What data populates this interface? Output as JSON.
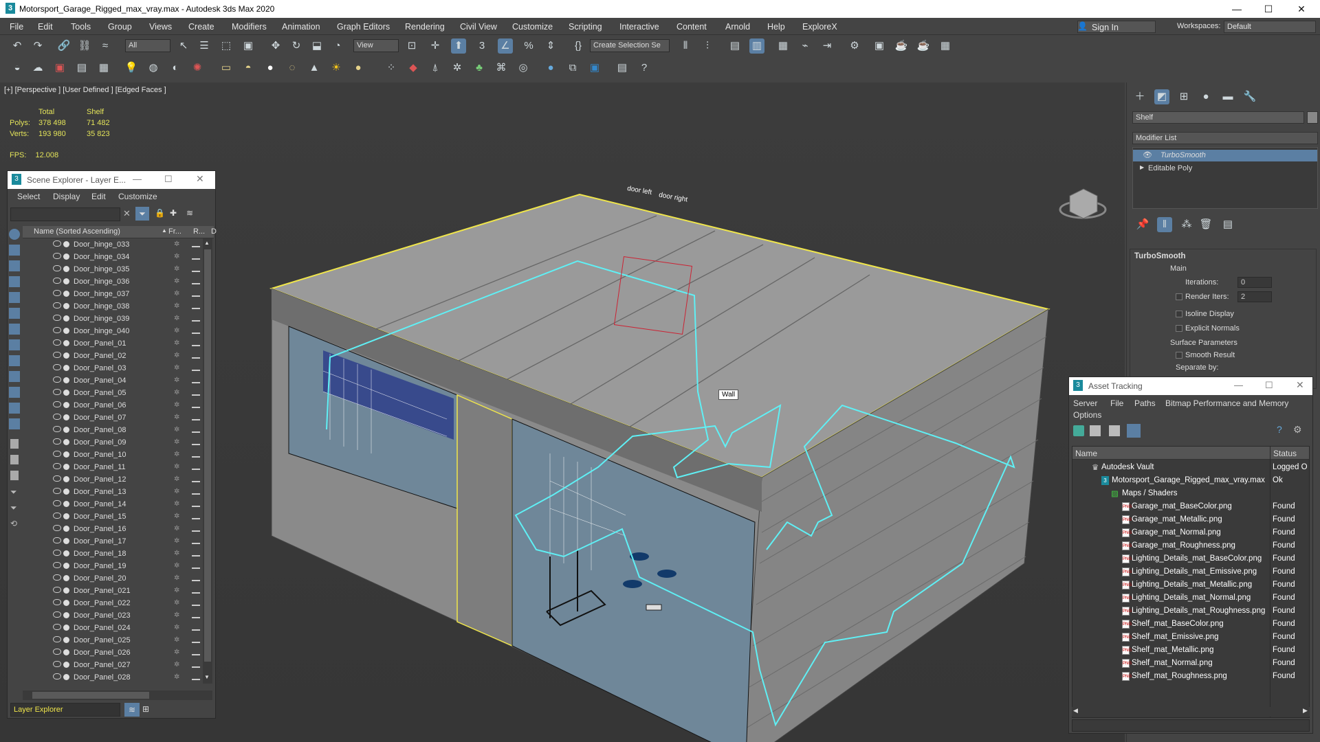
{
  "window": {
    "title": "Motorsport_Garage_Rigged_max_vray.max - Autodesk 3ds Max 2020",
    "min": "—",
    "max": "☐",
    "close": "✕"
  },
  "menu": [
    "File",
    "Edit",
    "Tools",
    "Group",
    "Views",
    "Create",
    "Modifiers",
    "Animation",
    "Graph Editors",
    "Rendering",
    "Civil View",
    "Customize",
    "Scripting",
    "Interactive",
    "Content",
    "Arnold",
    "Help",
    "ExploreX"
  ],
  "signin": {
    "label": "Sign In",
    "workspaces_label": "Workspaces:",
    "workspace": "Default"
  },
  "toolbar": {
    "filter": "All",
    "view": "View",
    "selset": "Create Selection Se",
    "snap_angle": "3"
  },
  "viewport": {
    "label": "[+] [Perspective ] [User Defined ] [Edged Faces ]",
    "stats": {
      "total_h": "Total",
      "shelf_h": "Shelf",
      "polys_l": "Polys:",
      "polys_total": "378 498",
      "polys_shelf": "71 482",
      "verts_l": "Verts:",
      "verts_total": "193 980",
      "verts_shelf": "35 823"
    },
    "fps_l": "FPS:",
    "fps": "12.008",
    "tooltip": "Wall",
    "door_left": "door left",
    "door_right": "door right"
  },
  "scene_explorer": {
    "title": "Scene Explorer - Layer E...",
    "menu": [
      "Select",
      "Display",
      "Edit",
      "Customize"
    ],
    "col_name": "Name (Sorted Ascending)",
    "col_fr": "Fr...",
    "col_r": "R...",
    "col_d": "D",
    "items": [
      "Door_hinge_033",
      "Door_hinge_034",
      "Door_hinge_035",
      "Door_hinge_036",
      "Door_hinge_037",
      "Door_hinge_038",
      "Door_hinge_039",
      "Door_hinge_040",
      "Door_Panel_01",
      "Door_Panel_02",
      "Door_Panel_03",
      "Door_Panel_04",
      "Door_Panel_05",
      "Door_Panel_06",
      "Door_Panel_07",
      "Door_Panel_08",
      "Door_Panel_09",
      "Door_Panel_10",
      "Door_Panel_11",
      "Door_Panel_12",
      "Door_Panel_13",
      "Door_Panel_14",
      "Door_Panel_15",
      "Door_Panel_16",
      "Door_Panel_17",
      "Door_Panel_18",
      "Door_Panel_19",
      "Door_Panel_20",
      "Door_Panel_021",
      "Door_Panel_022",
      "Door_Panel_023",
      "Door_Panel_024",
      "Door_Panel_025",
      "Door_Panel_026",
      "Door_Panel_027",
      "Door_Panel_028"
    ],
    "footer": "Layer Explorer"
  },
  "command_panel": {
    "object_name": "Shelf",
    "modifier_list": "Modifier List",
    "stack": [
      "TurboSmooth",
      "Editable Poly"
    ],
    "rollout": "TurboSmooth",
    "main": "Main",
    "iterations_l": "Iterations:",
    "iterations": "0",
    "render_iters_l": "Render Iters:",
    "render_iters": "2",
    "isoline": "Isoline Display",
    "explicit": "Explicit Normals",
    "surface": "Surface Parameters",
    "smooth": "Smooth Result",
    "separate": "Separate by:"
  },
  "asset_tracking": {
    "title": "Asset Tracking",
    "menu": [
      "Server",
      "File",
      "Paths",
      "Bitmap Performance and Memory"
    ],
    "options": "Options",
    "col_name": "Name",
    "col_status": "Status",
    "vault": {
      "name": "Autodesk Vault",
      "status": "Logged O"
    },
    "file": {
      "name": "Motorsport_Garage_Rigged_max_vray.max",
      "status": "Ok"
    },
    "maps": "Maps / Shaders",
    "items": [
      {
        "name": "Garage_mat_BaseColor.png",
        "status": "Found"
      },
      {
        "name": "Garage_mat_Metallic.png",
        "status": "Found"
      },
      {
        "name": "Garage_mat_Normal.png",
        "status": "Found"
      },
      {
        "name": "Garage_mat_Roughness.png",
        "status": "Found"
      },
      {
        "name": "Lighting_Details_mat_BaseColor.png",
        "status": "Found"
      },
      {
        "name": "Lighting_Details_mat_Emissive.png",
        "status": "Found"
      },
      {
        "name": "Lighting_Details_mat_Metallic.png",
        "status": "Found"
      },
      {
        "name": "Lighting_Details_mat_Normal.png",
        "status": "Found"
      },
      {
        "name": "Lighting_Details_mat_Roughness.png",
        "status": "Found"
      },
      {
        "name": "Shelf_mat_BaseColor.png",
        "status": "Found"
      },
      {
        "name": "Shelf_mat_Emissive.png",
        "status": "Found"
      },
      {
        "name": "Shelf_mat_Metallic.png",
        "status": "Found"
      },
      {
        "name": "Shelf_mat_Normal.png",
        "status": "Found"
      },
      {
        "name": "Shelf_mat_Roughness.png",
        "status": "Found"
      }
    ]
  }
}
